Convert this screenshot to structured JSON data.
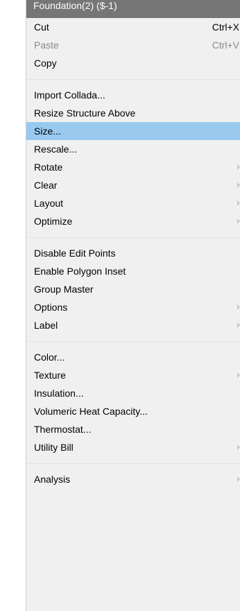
{
  "menu": {
    "header": "Foundation(2) ($-1)",
    "cut": {
      "label": "Cut",
      "shortcut": "Ctrl+X"
    },
    "paste": {
      "label": "Paste",
      "shortcut": "Ctrl+V"
    },
    "copy": {
      "label": "Copy"
    },
    "import_collada": {
      "label": "Import Collada..."
    },
    "resize_structure_above": {
      "label": "Resize Structure Above"
    },
    "size": {
      "label": "Size..."
    },
    "rescale": {
      "label": "Rescale..."
    },
    "rotate": {
      "label": "Rotate"
    },
    "clear": {
      "label": "Clear"
    },
    "layout": {
      "label": "Layout"
    },
    "optimize": {
      "label": "Optimize"
    },
    "disable_edit_points": {
      "label": "Disable Edit Points"
    },
    "enable_polygon_inset": {
      "label": "Enable Polygon Inset"
    },
    "group_master": {
      "label": "Group Master"
    },
    "options": {
      "label": "Options"
    },
    "label": {
      "label": "Label"
    },
    "color": {
      "label": "Color..."
    },
    "texture": {
      "label": "Texture"
    },
    "insulation": {
      "label": "Insulation..."
    },
    "volumetric_heat_capacity": {
      "label": "Volumeric Heat Capacity..."
    },
    "thermostat": {
      "label": "Thermostat..."
    },
    "utility_bill": {
      "label": "Utility Bill"
    },
    "analysis": {
      "label": "Analysis"
    }
  },
  "colors": {
    "menu_background": "#f0f0f0",
    "header_background": "#767676",
    "highlight": "#99c9ef",
    "disabled_text": "#8a8a8a"
  }
}
